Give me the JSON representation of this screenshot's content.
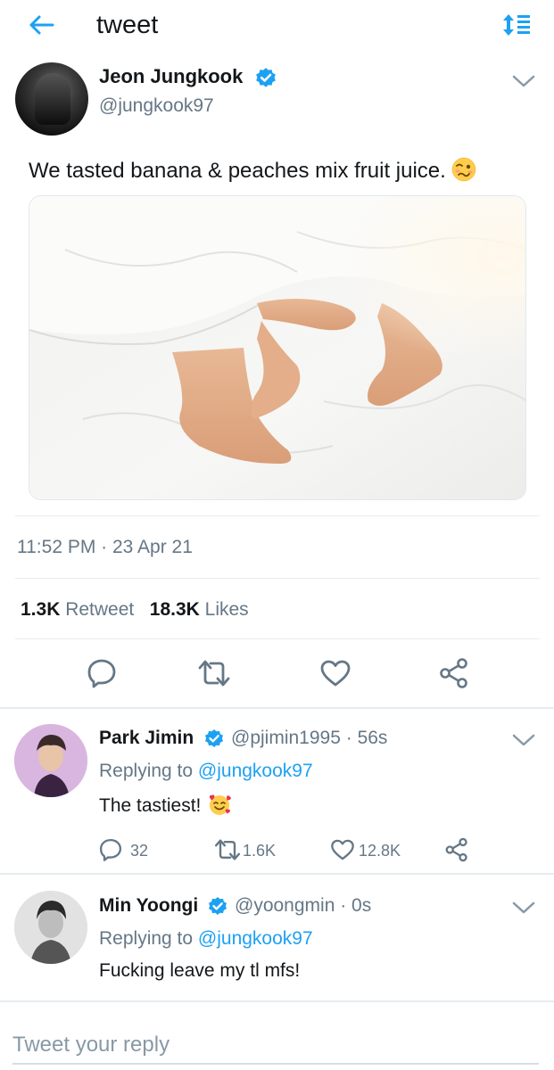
{
  "topbar": {
    "title": "tweet",
    "back_icon": "arrow-left-icon",
    "sort_icon": "sort-icon",
    "accent": "#1da1f2"
  },
  "tweet": {
    "author_name": "Jeon Jungkook",
    "author_handle": "@jungkook97",
    "text": "We tasted banana & peaches mix fruit juice.",
    "emoji": "woozy-face-emoji",
    "timestamp": "11:52 PM · 23 Apr 21",
    "retweets_count": "1.3K",
    "retweets_label": "Retweet",
    "likes_count": "18.3K",
    "likes_label": "Likes"
  },
  "replies": [
    {
      "name": "Park Jimin",
      "handle": "@pjimin1995",
      "time": "56s",
      "replying_label": "Replying to",
      "replying_to": "@jungkook97",
      "text": "The tastiest!",
      "emoji": "smiling-face-with-hearts-emoji",
      "reply_count": "32",
      "retweet_count": "1.6K",
      "like_count": "12.8K"
    },
    {
      "name": "Min Yoongi",
      "handle": "@yoongmin",
      "time": "0s",
      "replying_label": "Replying to",
      "replying_to": "@jungkook97",
      "text": "Fucking leave my tl mfs!"
    }
  ],
  "composer": {
    "placeholder": "Tweet your reply"
  },
  "colors": {
    "text": "#14171a",
    "secondary": "#657786",
    "link": "#1da1f2",
    "divider": "#e6ecf0",
    "icon": "#657786"
  }
}
